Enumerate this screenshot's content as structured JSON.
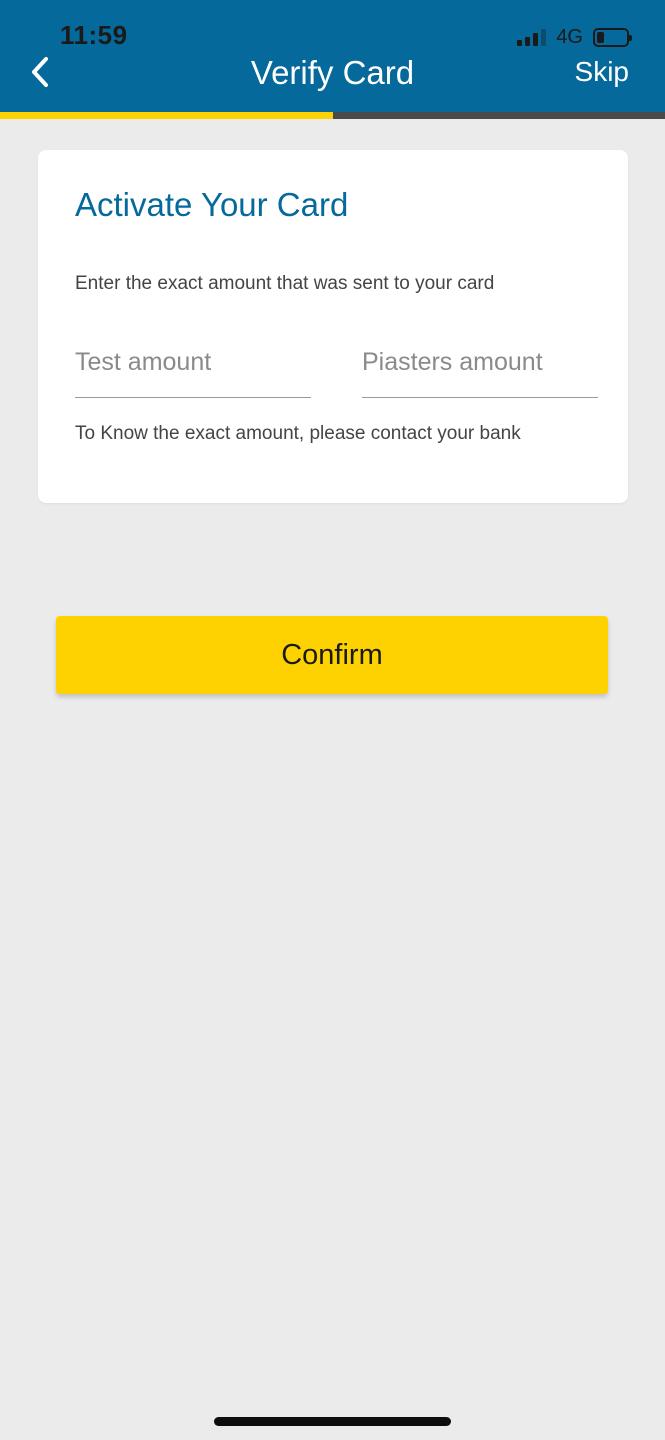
{
  "status_bar": {
    "time": "11:59",
    "network": "4G",
    "signal_bars": 3,
    "signal_total": 4,
    "battery_level": 0.25
  },
  "header": {
    "title": "Verify Card",
    "skip_label": "Skip",
    "back_icon": "chevron-left-icon",
    "background_color": "#05699b"
  },
  "progress": {
    "value": 0.5,
    "fill_color": "#fdd200",
    "track_color": "#4a4a4a"
  },
  "card": {
    "title": "Activate Your Card",
    "instruction": "Enter the exact amount that was sent to your card",
    "test_amount": {
      "placeholder": "Test amount",
      "value": ""
    },
    "piasters_amount": {
      "placeholder": "Piasters amount",
      "value": ""
    },
    "hint": "To Know the exact amount, please contact your bank",
    "title_color": "#05699b"
  },
  "confirm": {
    "label": "Confirm",
    "color": "#fdd200"
  }
}
